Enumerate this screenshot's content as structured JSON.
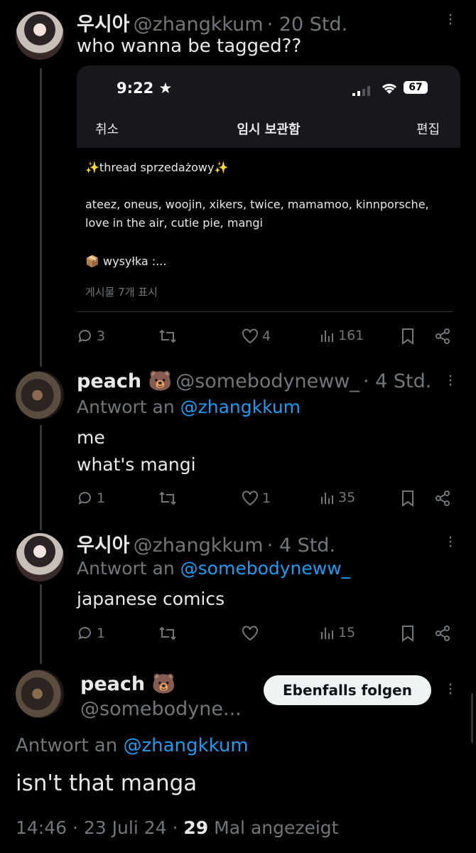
{
  "tweet1": {
    "name": "우시아",
    "handle": "@zhangkkum",
    "time": "· 20 Std.",
    "text": "who wanna be tagged??",
    "screenshot": {
      "status_time": "9:22",
      "battery": "67",
      "nav_cancel": "취소",
      "nav_title": "임시 보관함",
      "nav_edit": "편집",
      "line1": "✨thread sprzedażowy✨",
      "line2": "ateez, oneus, woojin, xikers, twice, mamamoo, kinnporsche,",
      "line3": "love in the air, cutie pie, mangi",
      "line4": "wysyłka :...",
      "footer": "게시물 7개 표시"
    },
    "replies": "3",
    "likes": "4",
    "views": "161"
  },
  "tweet2": {
    "name": "peach 🐻",
    "handle": "@somebodyneww_",
    "time": "· 4 Std.",
    "reply_prefix": "Antwort an",
    "reply_to": "@zhangkkum",
    "text": "me\nwhat's mangi",
    "replies": "1",
    "likes": "1",
    "views": "35"
  },
  "tweet3": {
    "name": "우시아",
    "handle": "@zhangkkum",
    "time": "· 4 Std.",
    "reply_prefix": "Antwort an",
    "reply_to": "@somebodyneww_",
    "text": "japanese comics",
    "replies": "1",
    "likes": "",
    "views": "15"
  },
  "main": {
    "name": "peach 🐻",
    "handle": "@somebodyne...",
    "follow_label": "Ebenfalls folgen",
    "reply_prefix": "Antwort an",
    "reply_to": "@zhangkkum",
    "text": "isn't that manga",
    "time": "14:46",
    "date": "23 Juli 24",
    "views_count": "29",
    "views_label": "Mal angezeigt",
    "sep": "·"
  },
  "colors": {
    "accent": "#1d9bf0",
    "muted": "#71767b",
    "text": "#e7e9ea"
  }
}
